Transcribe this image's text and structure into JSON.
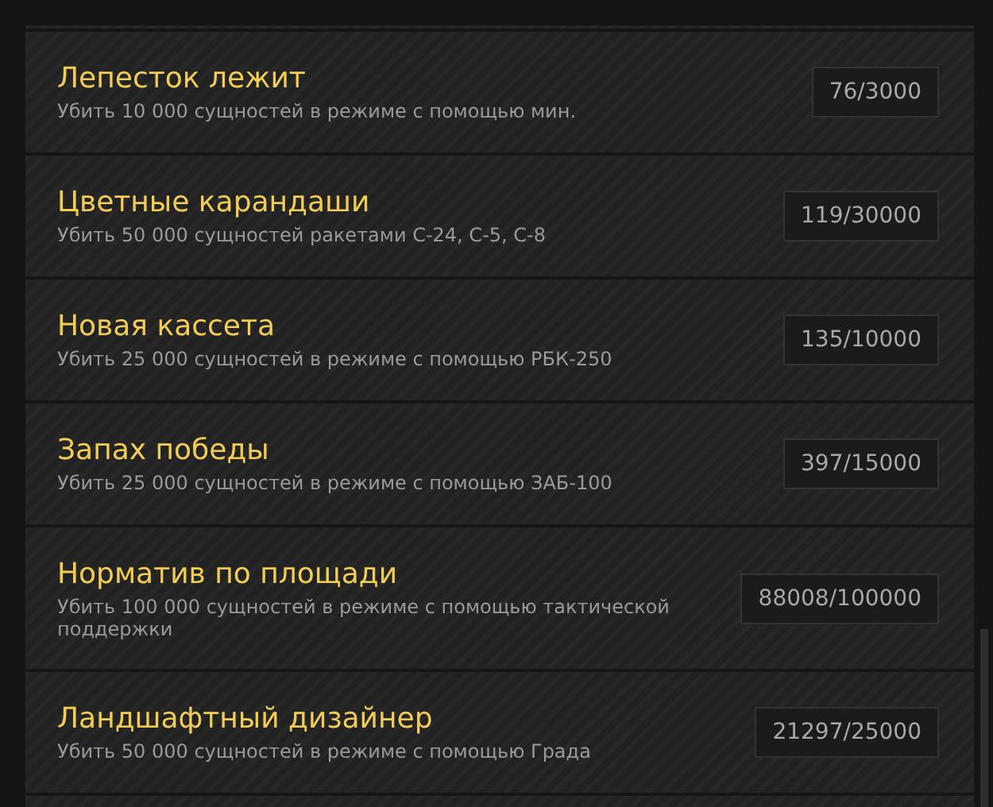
{
  "achievements": [
    {
      "title": "Лепесток лежит",
      "description": "Убить 10 000 сущностей в режиме с помощью мин.",
      "progress": "76/3000"
    },
    {
      "title": "Цветные карандаши",
      "description": "Убить 50 000 сущностей ракетами С-24, С-5, С-8",
      "progress": "119/30000"
    },
    {
      "title": "Новая кассета",
      "description": "Убить 25 000 сущностей в режиме с помощью РБК-250",
      "progress": "135/10000"
    },
    {
      "title": "Запах победы",
      "description": "Убить 25 000 сущностей в режиме с помощью ЗАБ-100",
      "progress": "397/15000"
    },
    {
      "title": "Норматив по площади",
      "description": "Убить 100 000 сущностей в режиме с помощью тактической поддержки",
      "progress": "88008/100000"
    },
    {
      "title": "Ландшафтный дизайнер",
      "description": "Убить 50 000 сущностей в режиме с помощью Града",
      "progress": "21297/25000"
    }
  ]
}
